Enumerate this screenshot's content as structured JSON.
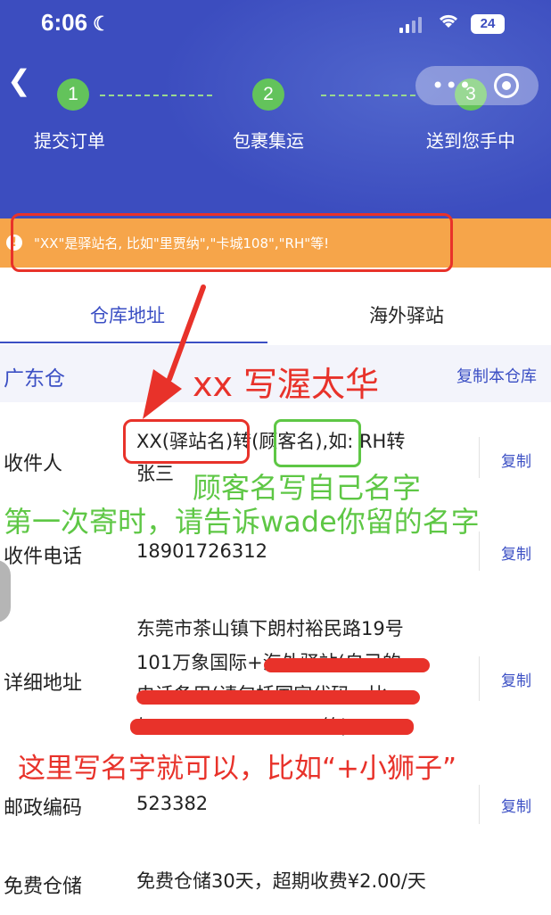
{
  "status_bar": {
    "time": "6:06",
    "battery": "24"
  },
  "steps": [
    {
      "num": "1",
      "label": "提交订单"
    },
    {
      "num": "2",
      "label": "包裹集运"
    },
    {
      "num": "3",
      "label": "送到您手中"
    }
  ],
  "capsule": {
    "more_glyph": "•••"
  },
  "notice": {
    "icon": "!",
    "text": "\"XX\"是驿站名, 比如\"里贾纳\",\"卡城108\",\"RH\"等!"
  },
  "tabs": [
    {
      "label": "仓库地址",
      "active": true
    },
    {
      "label": "海外驿站",
      "active": false
    }
  ],
  "warehouse": {
    "name": "广东仓",
    "copy_all": "复制本仓库"
  },
  "rows": {
    "recipient": {
      "label": "收件人",
      "line1": "XX(驿站名)转(顾客名),如: RH转",
      "line2": "张三",
      "copy": "复制"
    },
    "phone": {
      "label": "收件电话",
      "value": "18901726312",
      "copy": "复制"
    },
    "address": {
      "label": "详细地址",
      "line1": "东莞市茶山镇下朗村裕民路19号",
      "line2": "101万象国际+海外驿站(自己的",
      "line3": "电话备用(请包括国家代码，比",
      "line4": "如+1-144-443-2551等)",
      "copy": "复制"
    },
    "postcode": {
      "label": "邮政编码",
      "value": "523382",
      "copy": "复制"
    },
    "storage": {
      "label": "免费仓储",
      "value": "免费仓储30天，超期收费¥2.00/天"
    }
  },
  "annotations": {
    "xx_note": "xx 写渥太华",
    "customer_note": "顾客名写自己名字",
    "first_send_note": "第一次寄时，请告诉wade你留的名字",
    "name_note": "这里写名字就可以，比如“+小狮子”"
  },
  "colors": {
    "header": "#3c4dbf",
    "accent": "#3b4fc4",
    "notice": "#f6a54a",
    "step": "#63c35b",
    "annotation_red": "#e8322a",
    "annotation_green": "#5ec745"
  },
  "icons": {
    "back": "back-chevron-icon",
    "moon": "moon-icon",
    "signal": "signal-icon",
    "wifi": "wifi-icon",
    "battery": "battery-icon",
    "more": "more-icon",
    "close": "target-icon",
    "warning": "warning-icon"
  }
}
